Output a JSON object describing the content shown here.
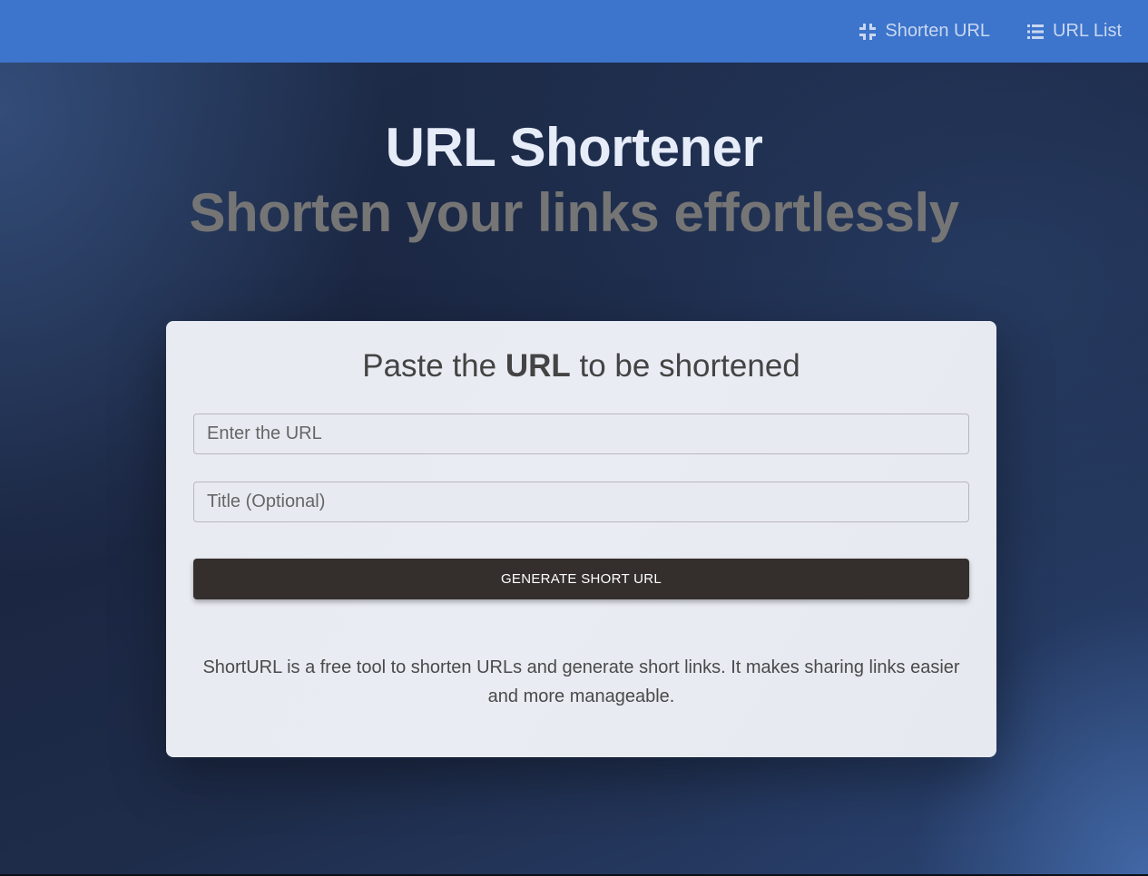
{
  "nav": {
    "items": [
      {
        "label": "Shorten URL",
        "icon": "compress-icon"
      },
      {
        "label": "URL List",
        "icon": "list-icon"
      }
    ]
  },
  "hero": {
    "title": "URL Shortener",
    "subtitle": "Shorten your links effortlessly"
  },
  "card": {
    "heading_prefix": "Paste the ",
    "heading_bold": "URL",
    "heading_suffix": " to be shortened",
    "url_input": {
      "placeholder": "Enter the URL",
      "value": ""
    },
    "title_input": {
      "placeholder": "Title (Optional)",
      "value": ""
    },
    "button_label": "GENERATE SHORT URL",
    "description": "ShortURL is a free tool to shorten URLs and generate short links. It makes sharing links easier and more manageable."
  },
  "colors": {
    "navbar": "#3d74cc",
    "button": "#342e2d",
    "subtitle": "#757575"
  }
}
